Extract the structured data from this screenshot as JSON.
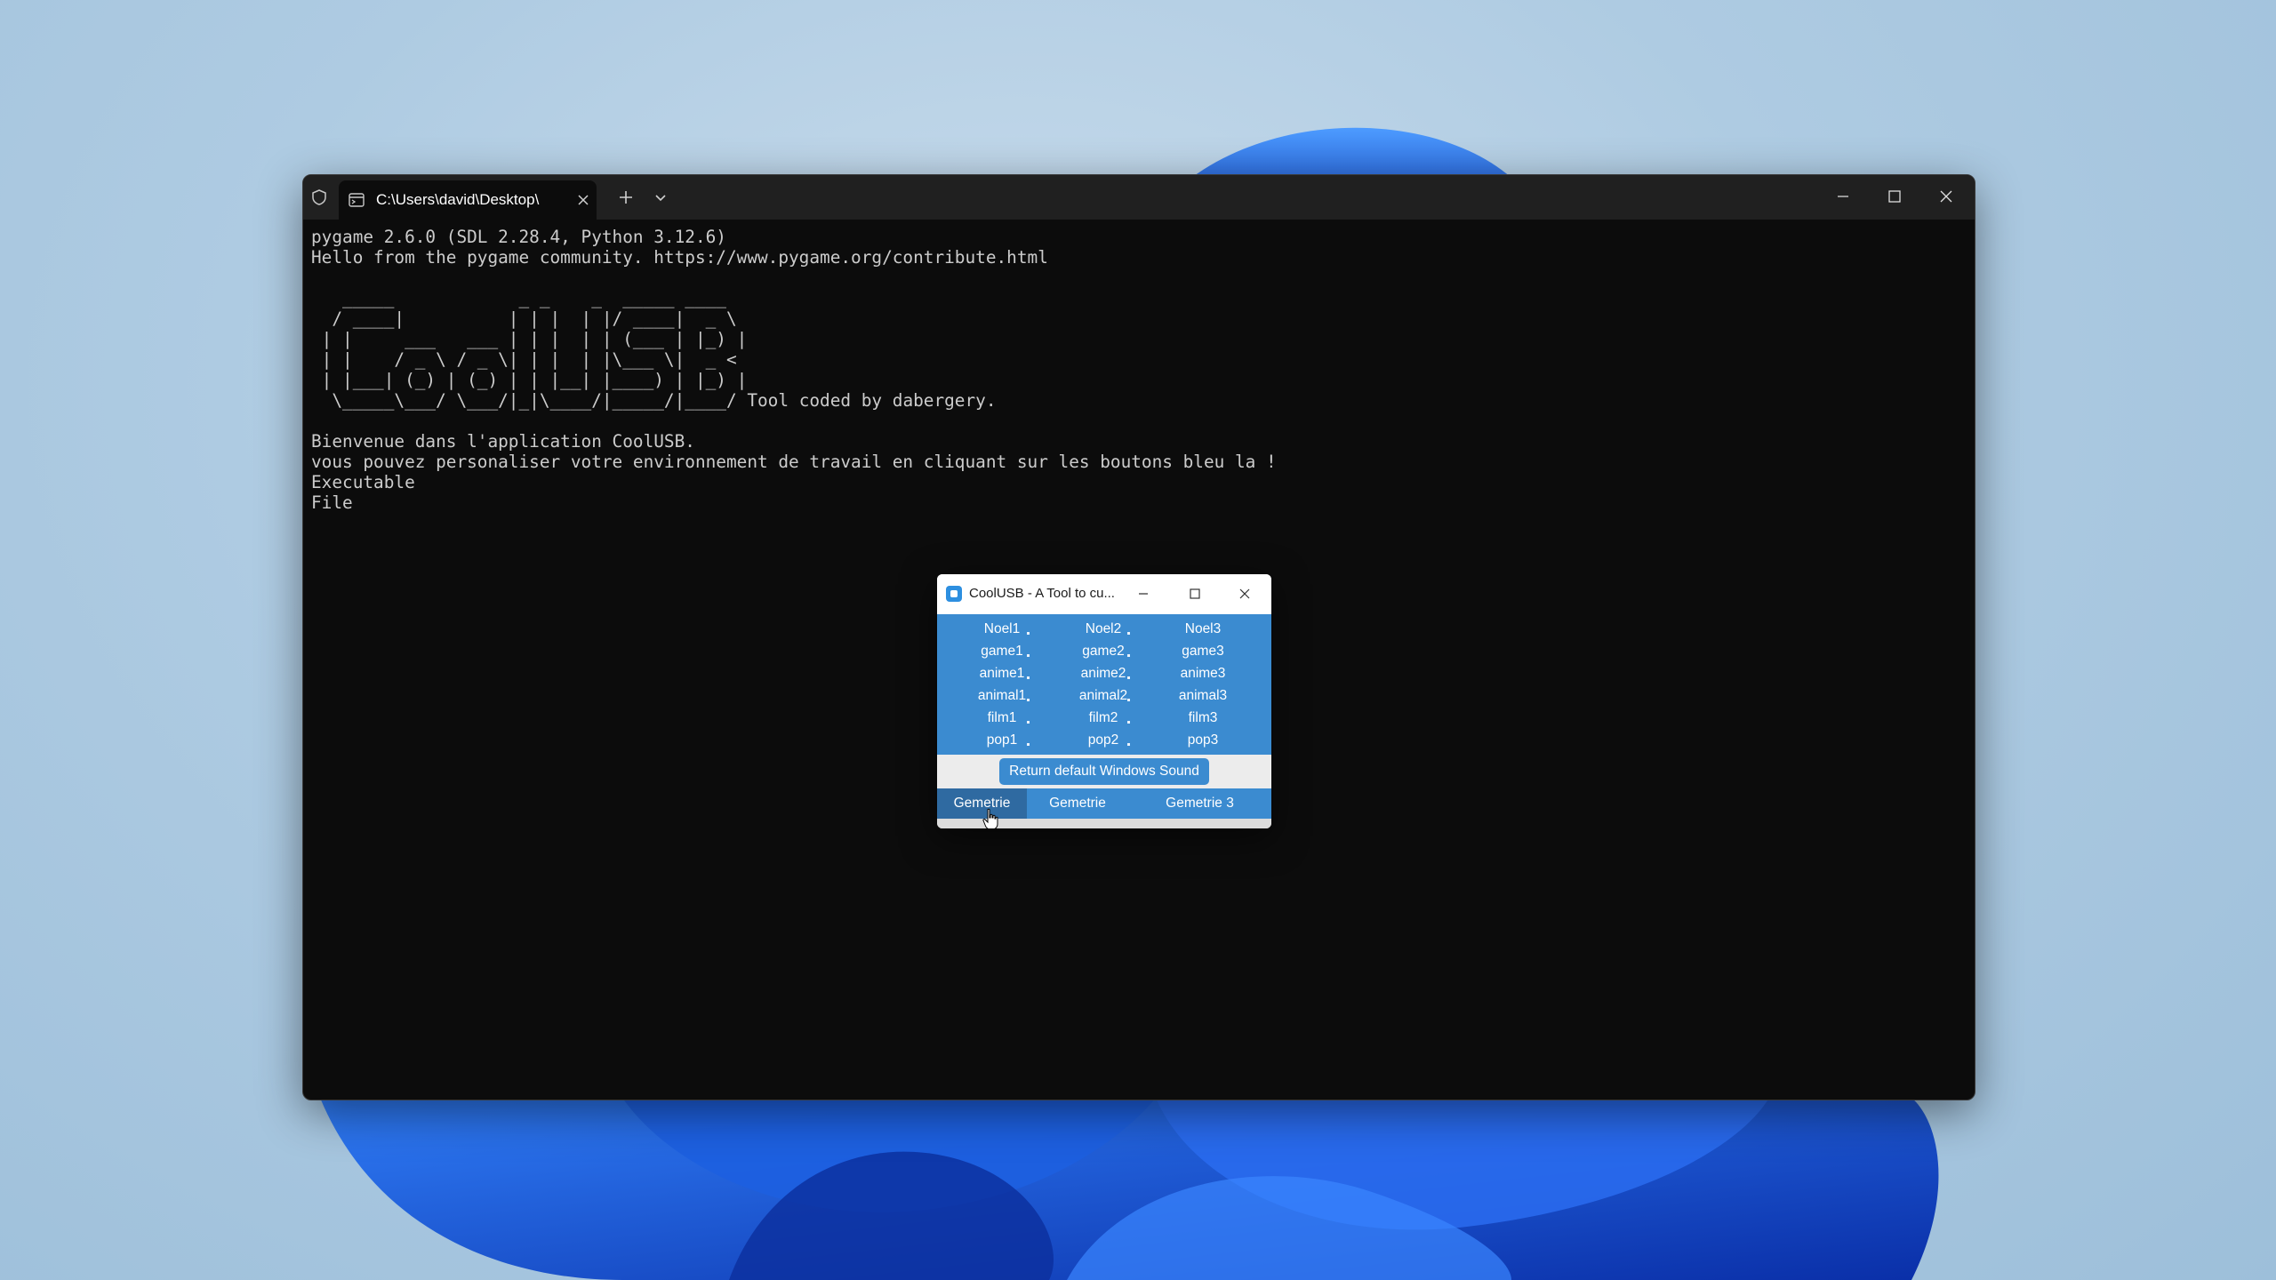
{
  "terminal": {
    "tab_title": "C:\\Users\\david\\Desktop\\",
    "lines_top": [
      "pygame 2.6.0 (SDL 2.28.4, Python 3.12.6)",
      "Hello from the pygame community. https://www.pygame.org/contribute.html"
    ],
    "ascii_art": [
      "   _____            _ _    _  _____ ____  ",
      "  / ____|          | | |  | |/ ____|  _ \\ ",
      " | |     ___   ___ | | |  | | (___ | |_) |",
      " | |    / _ \\ / _ \\| | |  | |\\___ \\|  _ < ",
      " | |___| (_) | (_) | | |__| |____) | |_) |",
      "  \\_____\\___/ \\___/|_|\\____/|_____/|____/ "
    ],
    "credit": "Tool coded by dabergery.",
    "lines_bottom": [
      "Bienvenue dans l'application CoolUSB.",
      "vous pouvez personaliser votre environnement de travail en cliquant sur les boutons bleu la !",
      "Executable",
      "File"
    ]
  },
  "dialog": {
    "title": "CoolUSB - A Tool to cu...",
    "columns": [
      [
        "Noel1",
        "game1",
        "anime1",
        "animal1",
        "film1",
        "pop1"
      ],
      [
        "Noel2",
        "game2",
        "anime2",
        "animal2",
        "film2",
        "pop2"
      ],
      [
        "Noel3",
        "game3",
        "anime3",
        "animal3",
        "film3",
        "pop3"
      ]
    ],
    "sound_button": "Return default Windows Sound",
    "geometry_buttons": [
      "Gemetrie",
      "Gemetrie",
      "Gemetrie 3"
    ]
  },
  "colors": {
    "accent": "#3b8bd0",
    "terminal_bg": "#0c0c0c",
    "terminal_text": "#cccccc"
  }
}
